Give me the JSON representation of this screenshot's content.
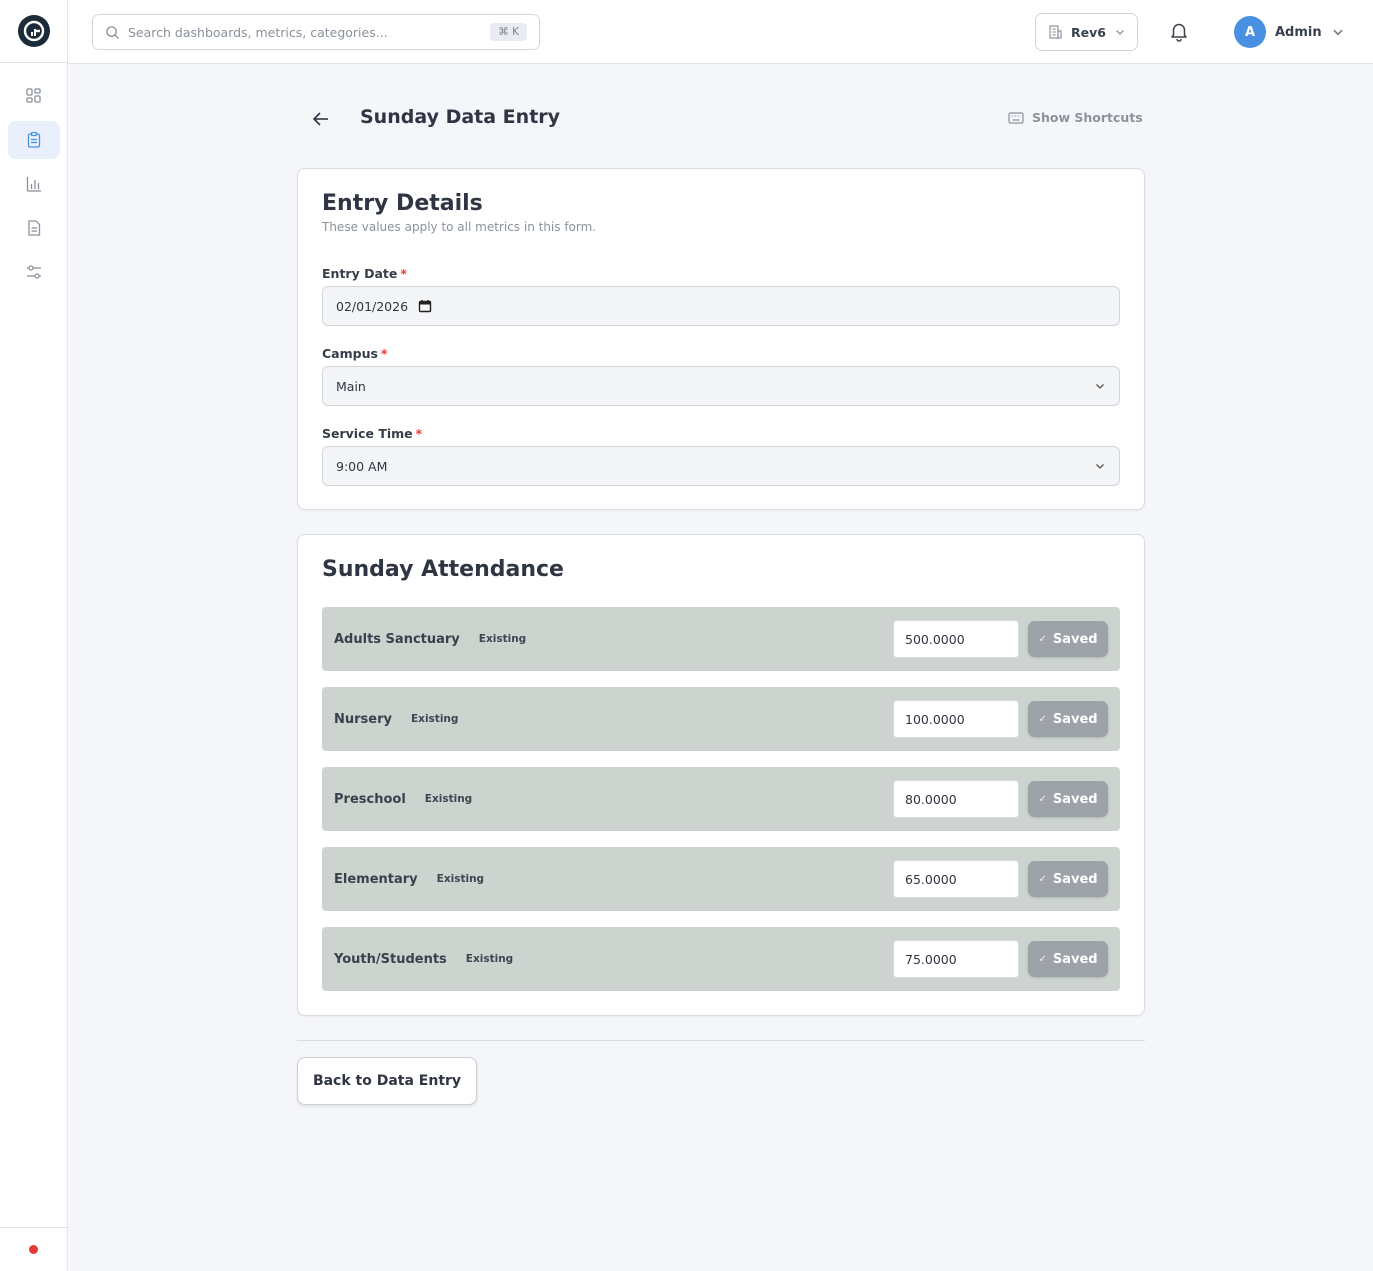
{
  "header": {
    "search_placeholder": "Search dashboards, metrics, categories...",
    "search_shortcut": "⌘ K",
    "org_name": "Rev6",
    "user_initial": "A",
    "user_name": "Admin"
  },
  "page": {
    "title": "Sunday Data Entry",
    "shortcuts_label": "Show Shortcuts"
  },
  "entry_details": {
    "title": "Entry Details",
    "subtitle": "These values apply to all metrics in this form.",
    "date_label": "Entry Date",
    "date_value": "02/01/2026",
    "campus_label": "Campus",
    "campus_value": "Main",
    "service_label": "Service Time",
    "service_value": "9:00 AM",
    "required_marker": "*"
  },
  "attendance": {
    "title": "Sunday Attendance",
    "saved_label": "Saved",
    "check_glyph": "✓",
    "rows": [
      {
        "name": "Adults Sanctuary",
        "badge": "Existing",
        "value": "500.0000"
      },
      {
        "name": "Nursery",
        "badge": "Existing",
        "value": "100.0000"
      },
      {
        "name": "Preschool",
        "badge": "Existing",
        "value": "80.0000"
      },
      {
        "name": "Elementary",
        "badge": "Existing",
        "value": "65.0000"
      },
      {
        "name": "Youth/Students",
        "badge": "Existing",
        "value": "75.0000"
      }
    ]
  },
  "footer": {
    "back_label": "Back to Data Entry"
  },
  "colors": {
    "accent": "#4a90e2",
    "row_bg": "#cdd3ce",
    "saved_bg": "#9ca2a8",
    "required": "#e53935",
    "status_dot": "#e53935"
  }
}
